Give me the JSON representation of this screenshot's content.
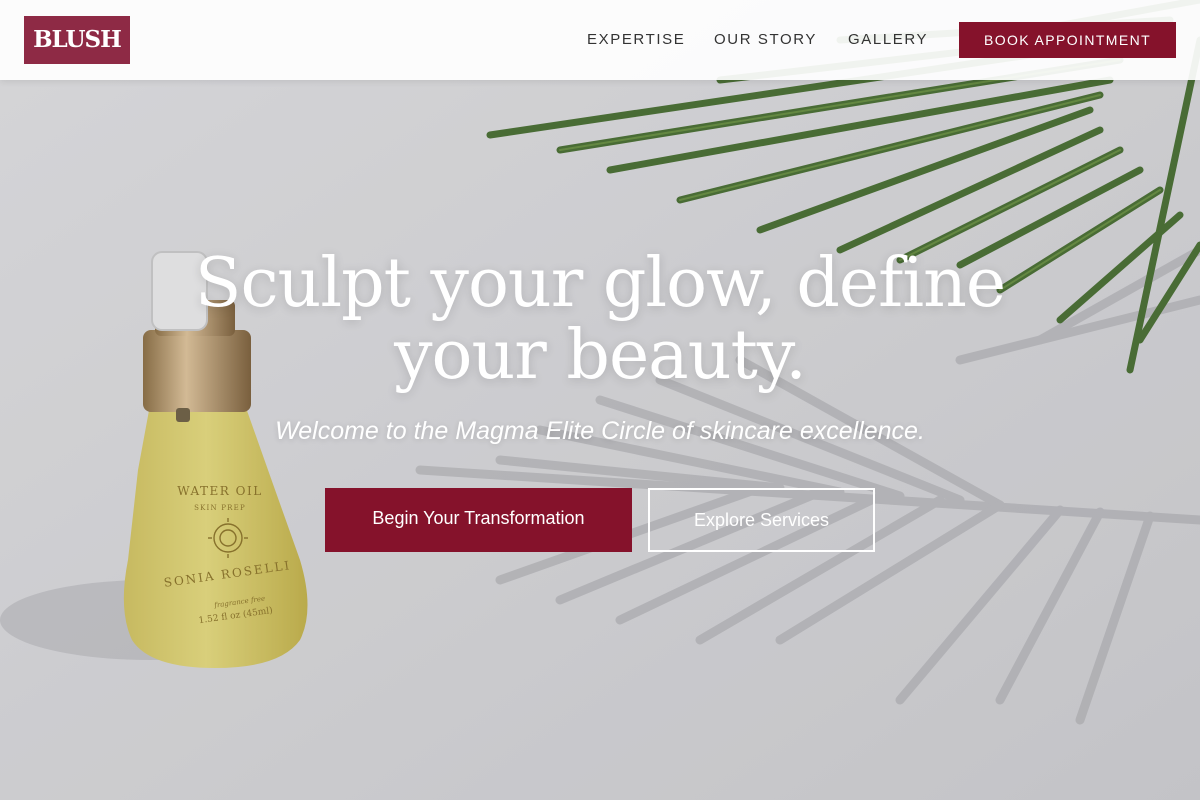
{
  "header": {
    "logo_text": "BLUSH",
    "nav": [
      {
        "label": "EXPERTISE"
      },
      {
        "label": "OUR STORY"
      },
      {
        "label": "GALLERY"
      }
    ],
    "cta_label": "BOOK APPOINTMENT"
  },
  "hero": {
    "headline_line1": "Sculpt your glow, define",
    "headline_line2": "your beauty.",
    "subheadline": "Welcome to the Magma Elite Circle of skincare excellence.",
    "primary_button": "Begin Your Transformation",
    "secondary_button": "Explore Services"
  },
  "product": {
    "line1": "WATER OIL",
    "line2": "SKIN PREP",
    "brand": "SONIA ROSELLI",
    "fragrance": "fragrance free",
    "volume": "1.52 fl oz (45ml)"
  },
  "colors": {
    "brand_primary": "#85122b",
    "logo_bg": "#8e2a45",
    "text_on_hero": "#ffffff",
    "nav_text": "#333333"
  },
  "icons": [
    "sun-emblem-icon"
  ]
}
